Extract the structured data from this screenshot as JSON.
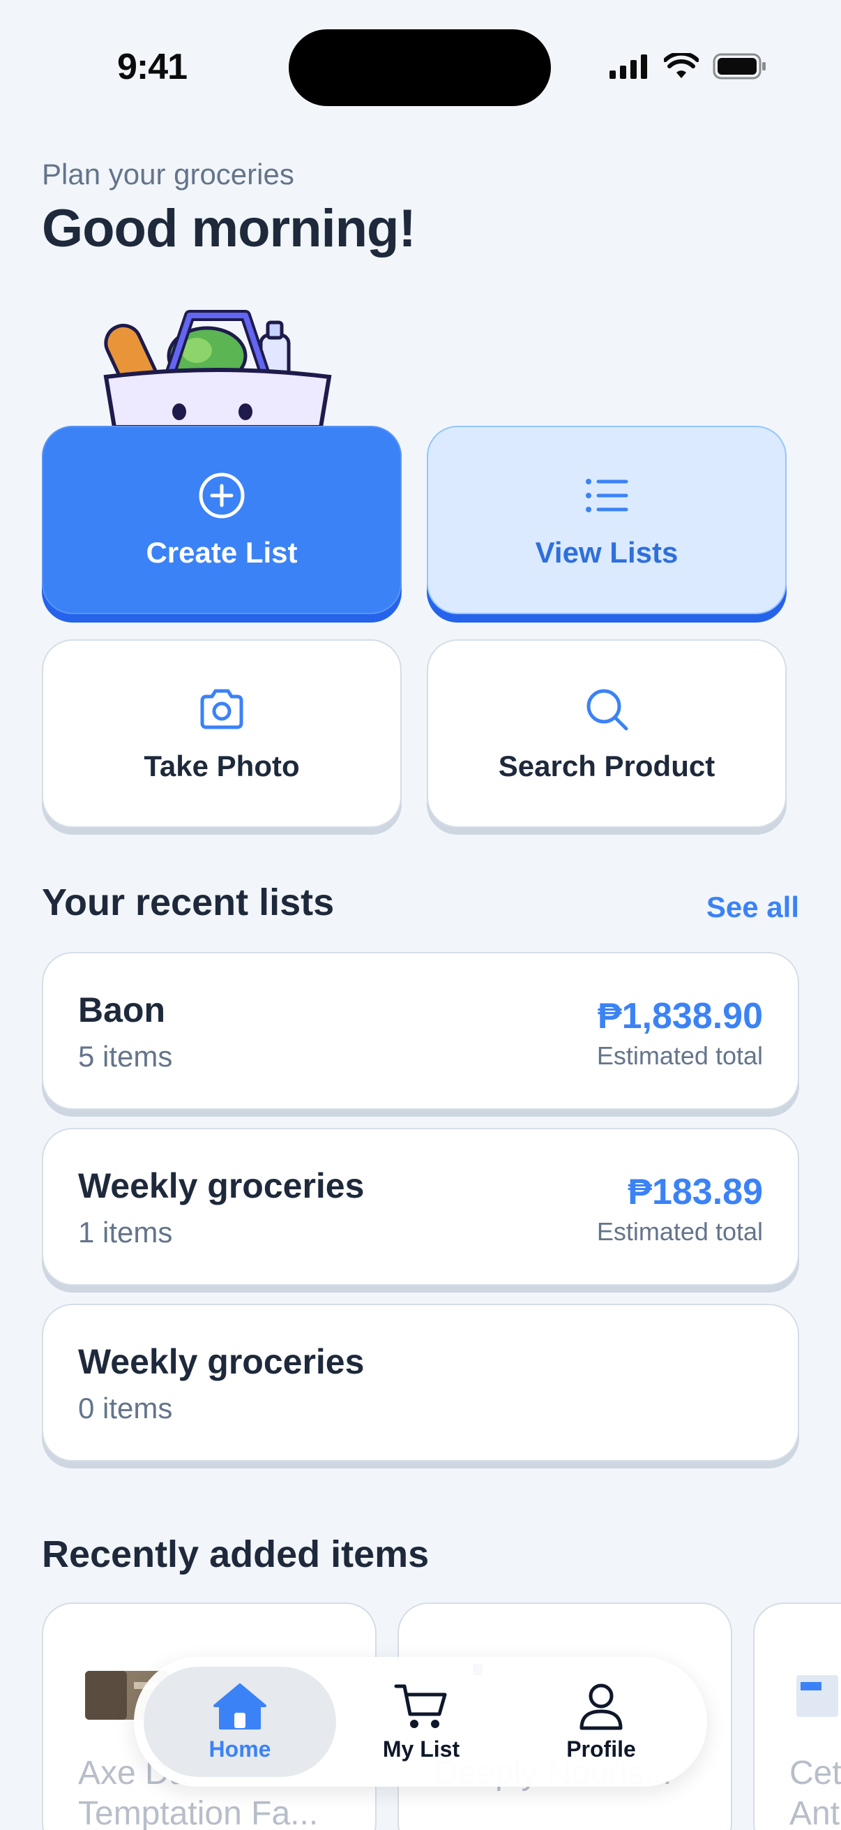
{
  "status": {
    "time": "9:41"
  },
  "header": {
    "subtitle": "Plan your groceries",
    "greeting": "Good morning!"
  },
  "actions": {
    "create": "Create List",
    "view": "View Lists",
    "photo": "Take Photo",
    "search": "Search Product"
  },
  "recent_lists": {
    "title": "Your recent lists",
    "see_all": "See all",
    "items": [
      {
        "name": "Baon",
        "count": "5 items",
        "price": "₱1,838.90",
        "estimate": "Estimated total"
      },
      {
        "name": "Weekly groceries",
        "count": "1 items",
        "price": "₱183.89",
        "estimate": "Estimated total"
      },
      {
        "name": "Weekly groceries",
        "count": "0 items"
      }
    ]
  },
  "recent_items": {
    "title": "Recently added items",
    "items": [
      {
        "line1": "Axe Da",
        "line2": "Temptation Fa..."
      },
      {
        "line1": "",
        "line2": "Deeply Nouris..."
      },
      {
        "line1": "Cet",
        "line2": "Ant"
      }
    ]
  },
  "nav": {
    "home": "Home",
    "list": "My List",
    "profile": "Profile"
  },
  "colors": {
    "accent": "#3b82f6",
    "accent_light": "#dbeafe",
    "text": "#1e293b",
    "muted": "#64748b"
  },
  "icons": [
    "signal-icon",
    "wifi-icon",
    "battery-icon",
    "plus-circle-icon",
    "list-icon",
    "camera-icon",
    "search-icon",
    "home-icon",
    "cart-icon",
    "user-icon"
  ]
}
